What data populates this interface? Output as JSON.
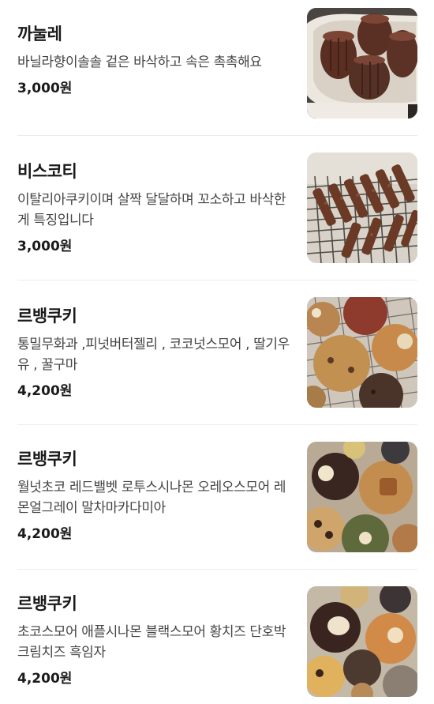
{
  "menu": {
    "items": [
      {
        "name": "까눌레",
        "description": "바닐라향이솔솔 겉은 바삭하고 속은 촉촉해요",
        "price": "3,000원",
        "photo": "canele-photo"
      },
      {
        "name": "비스코티",
        "description": "이탈리아쿠키이며 살짝 달달하며 꼬소하고 바삭한게 특징입니다",
        "price": "3,000원",
        "photo": "biscotti-photo"
      },
      {
        "name": "르뱅쿠키",
        "description": "통밀무화과 ,피넛버터젤리 , 코코넛스모어 , 딸기우유 , 꿀구마",
        "price": "4,200원",
        "photo": "levain-cookie-photo"
      },
      {
        "name": "르뱅쿠키",
        "description": "월넛초코 레드밸벳 로투스시나몬 오레오스모어 레몬얼그레이 말차마카다미아",
        "price": "4,200원",
        "photo": "levain-cookie-photo"
      },
      {
        "name": "르뱅쿠키",
        "description": "초코스모어 애플시나몬 블랙스모어 황치즈 단호박크림치즈 흑임자",
        "price": "4,200원",
        "photo": "levain-cookie-photo"
      }
    ]
  }
}
